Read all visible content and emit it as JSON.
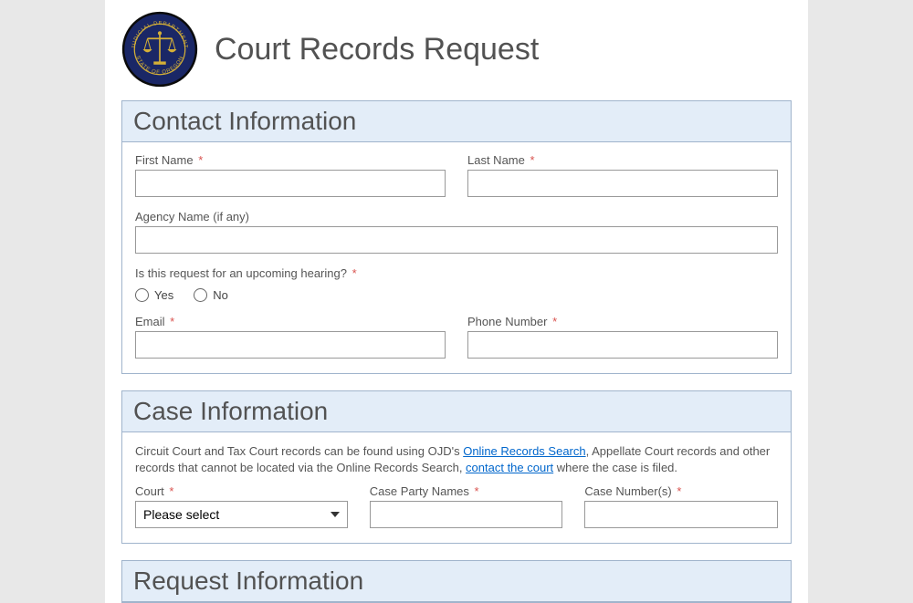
{
  "header": {
    "title": "Court Records Request",
    "seal_outer_text": "JUDICIAL DEPARTMENT · STATE OF OREGON"
  },
  "sections": {
    "contact": {
      "title": "Contact Information",
      "fields": {
        "first_name_label": "First Name",
        "last_name_label": "Last Name",
        "agency_label": "Agency Name (if any)",
        "hearing_question": "Is this request for an upcoming hearing?",
        "hearing_yes": "Yes",
        "hearing_no": "No",
        "email_label": "Email",
        "phone_label": "Phone Number"
      }
    },
    "case": {
      "title": "Case Information",
      "info_prefix": "Circuit Court and Tax Court records can be found using OJD's ",
      "info_link1": "Online Records Search",
      "info_mid": ", Appellate Court records and other records that cannot be located via the Online Records Search, ",
      "info_link2": "contact the court",
      "info_suffix": " where the case is filed.",
      "fields": {
        "court_label": "Court",
        "court_placeholder": "Please select",
        "party_label": "Case Party Names",
        "case_number_label": "Case Number(s)"
      }
    },
    "request": {
      "title": "Request Information"
    }
  },
  "required_marker": "*"
}
